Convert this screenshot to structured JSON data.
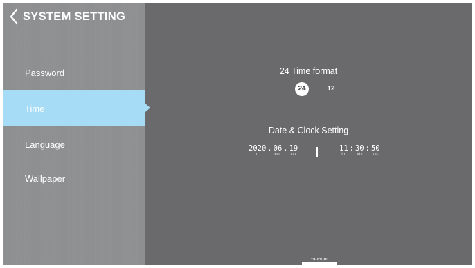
{
  "header": {
    "title": "SYSTEM SETTING"
  },
  "sidebar": {
    "items": [
      {
        "label": "Password"
      },
      {
        "label": "Time",
        "active": true
      },
      {
        "label": "Language"
      },
      {
        "label": "Wallpaper"
      }
    ]
  },
  "time_format": {
    "title": "24 Time format",
    "options": [
      "24",
      "12"
    ],
    "selected": "24"
  },
  "date_clock": {
    "title": "Date & Clock Setting",
    "date": {
      "year": "2020",
      "month": "06",
      "day": "19",
      "year_unit": "yr",
      "month_unit": "mon",
      "day_unit": "day",
      "separator": "."
    },
    "time": {
      "hour": "11",
      "minute": "30",
      "second": "50",
      "hour_unit": "hr",
      "minute_unit": "min",
      "second_unit": "sec",
      "separator": ":"
    }
  },
  "footer": {
    "label": "TIMETIME"
  },
  "colors": {
    "panel": "#6a6a6c",
    "sidebar": "#8e8f91",
    "accent": "#a6dcf6"
  }
}
